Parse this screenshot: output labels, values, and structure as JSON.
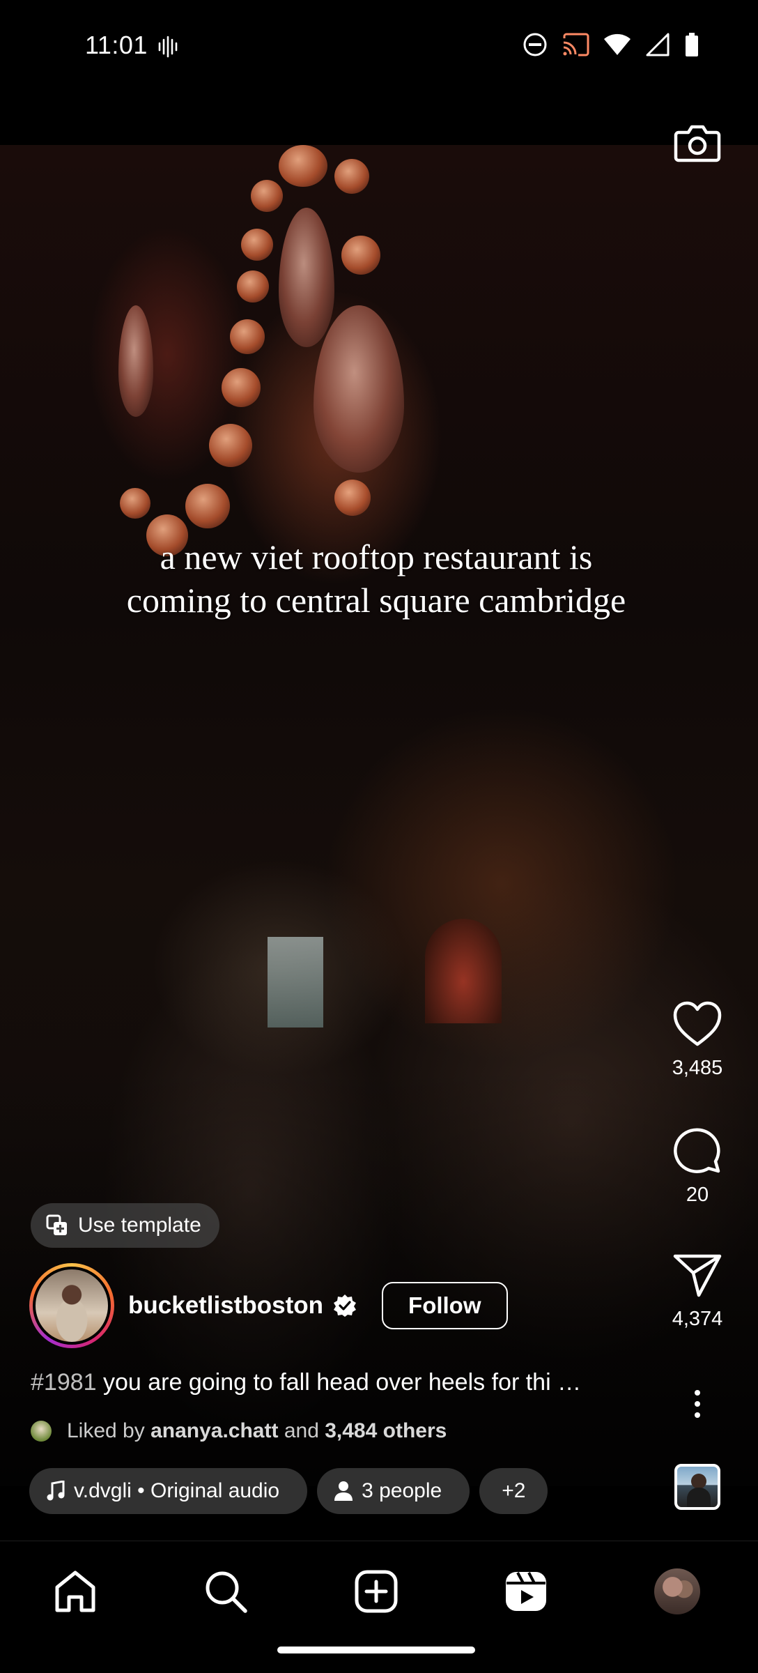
{
  "status_bar": {
    "time": "11:01",
    "icons": [
      "vibrate-icon",
      "do-not-disturb-icon",
      "cast-icon",
      "wifi-icon",
      "signal-icon",
      "battery-icon"
    ]
  },
  "reel": {
    "overlay_text_line1": "a new viet rooftop restaurant is",
    "overlay_text_line2": "coming to central square cambridge",
    "camera_icon": "camera-icon"
  },
  "actions": {
    "like_count": "3,485",
    "comment_count": "20",
    "share_count": "4,374",
    "icons": [
      "heart-icon",
      "comment-icon",
      "share-icon",
      "more-icon"
    ]
  },
  "template": {
    "label": "Use template"
  },
  "author": {
    "username": "bucketlistboston",
    "follow_label": "Follow"
  },
  "caption": {
    "hashtag": "#1981",
    "text": " you are going to fall head over heels for thi …"
  },
  "likes": {
    "prefix": "Liked by ",
    "user": "ananya.chatt",
    "middle": " and ",
    "others": "3,484 others"
  },
  "chips": {
    "audio": "v.dvgli • Original audio",
    "people": "3 people",
    "more": "+2"
  },
  "nav": {
    "items": [
      "home-icon",
      "search-icon",
      "create-icon",
      "reels-icon",
      "profile-avatar"
    ]
  },
  "colors": {
    "background": "#000000",
    "text": "#ffffff",
    "chip_background": "#464646"
  }
}
